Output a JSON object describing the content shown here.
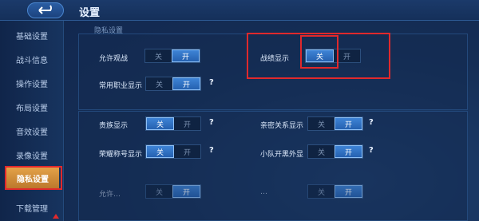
{
  "header": {
    "title": "设置",
    "back_icon": "back-arrow-icon"
  },
  "sidebar": {
    "items": [
      {
        "label": "基础设置"
      },
      {
        "label": "战斗信息"
      },
      {
        "label": "操作设置"
      },
      {
        "label": "布局设置"
      },
      {
        "label": "音效设置"
      },
      {
        "label": "录像设置"
      },
      {
        "label": "隐私设置",
        "active": true
      },
      {
        "label": "下载管理"
      }
    ]
  },
  "privacy": {
    "section_title": "隐私设置",
    "allow_watch": {
      "label": "允许观战",
      "off": "关",
      "on": "开",
      "selected": "开"
    },
    "battle_record": {
      "label": "战绩显示",
      "off": "关",
      "on": "开",
      "selected": "关"
    },
    "common_role": {
      "label": "常用职业显示",
      "off": "关",
      "on": "开",
      "selected": "开",
      "help": "?"
    }
  },
  "social": {
    "noble": {
      "label": "贵族显示",
      "off": "关",
      "on": "开",
      "selected": "关",
      "help": "?"
    },
    "intimacy": {
      "label": "亲密关系显示",
      "off": "关",
      "on": "开",
      "selected": "开",
      "help": "?"
    },
    "honor_title": {
      "label": "荣耀称号显示",
      "off": "关",
      "on": "开",
      "selected": "关",
      "help": "?"
    },
    "team_skin": {
      "label": "小队开黑外显",
      "off": "关",
      "on": "开",
      "selected": "开",
      "help": "?"
    },
    "row5_left": {
      "label": "允许…",
      "off": "关",
      "on": "开",
      "selected": "开"
    },
    "row5_right": {
      "label": "…",
      "off": "关",
      "on": "开",
      "selected": "开"
    }
  },
  "colors": {
    "accent": "#2561b0",
    "active_tab": "#e7a54a",
    "highlight": "#e0292c"
  }
}
